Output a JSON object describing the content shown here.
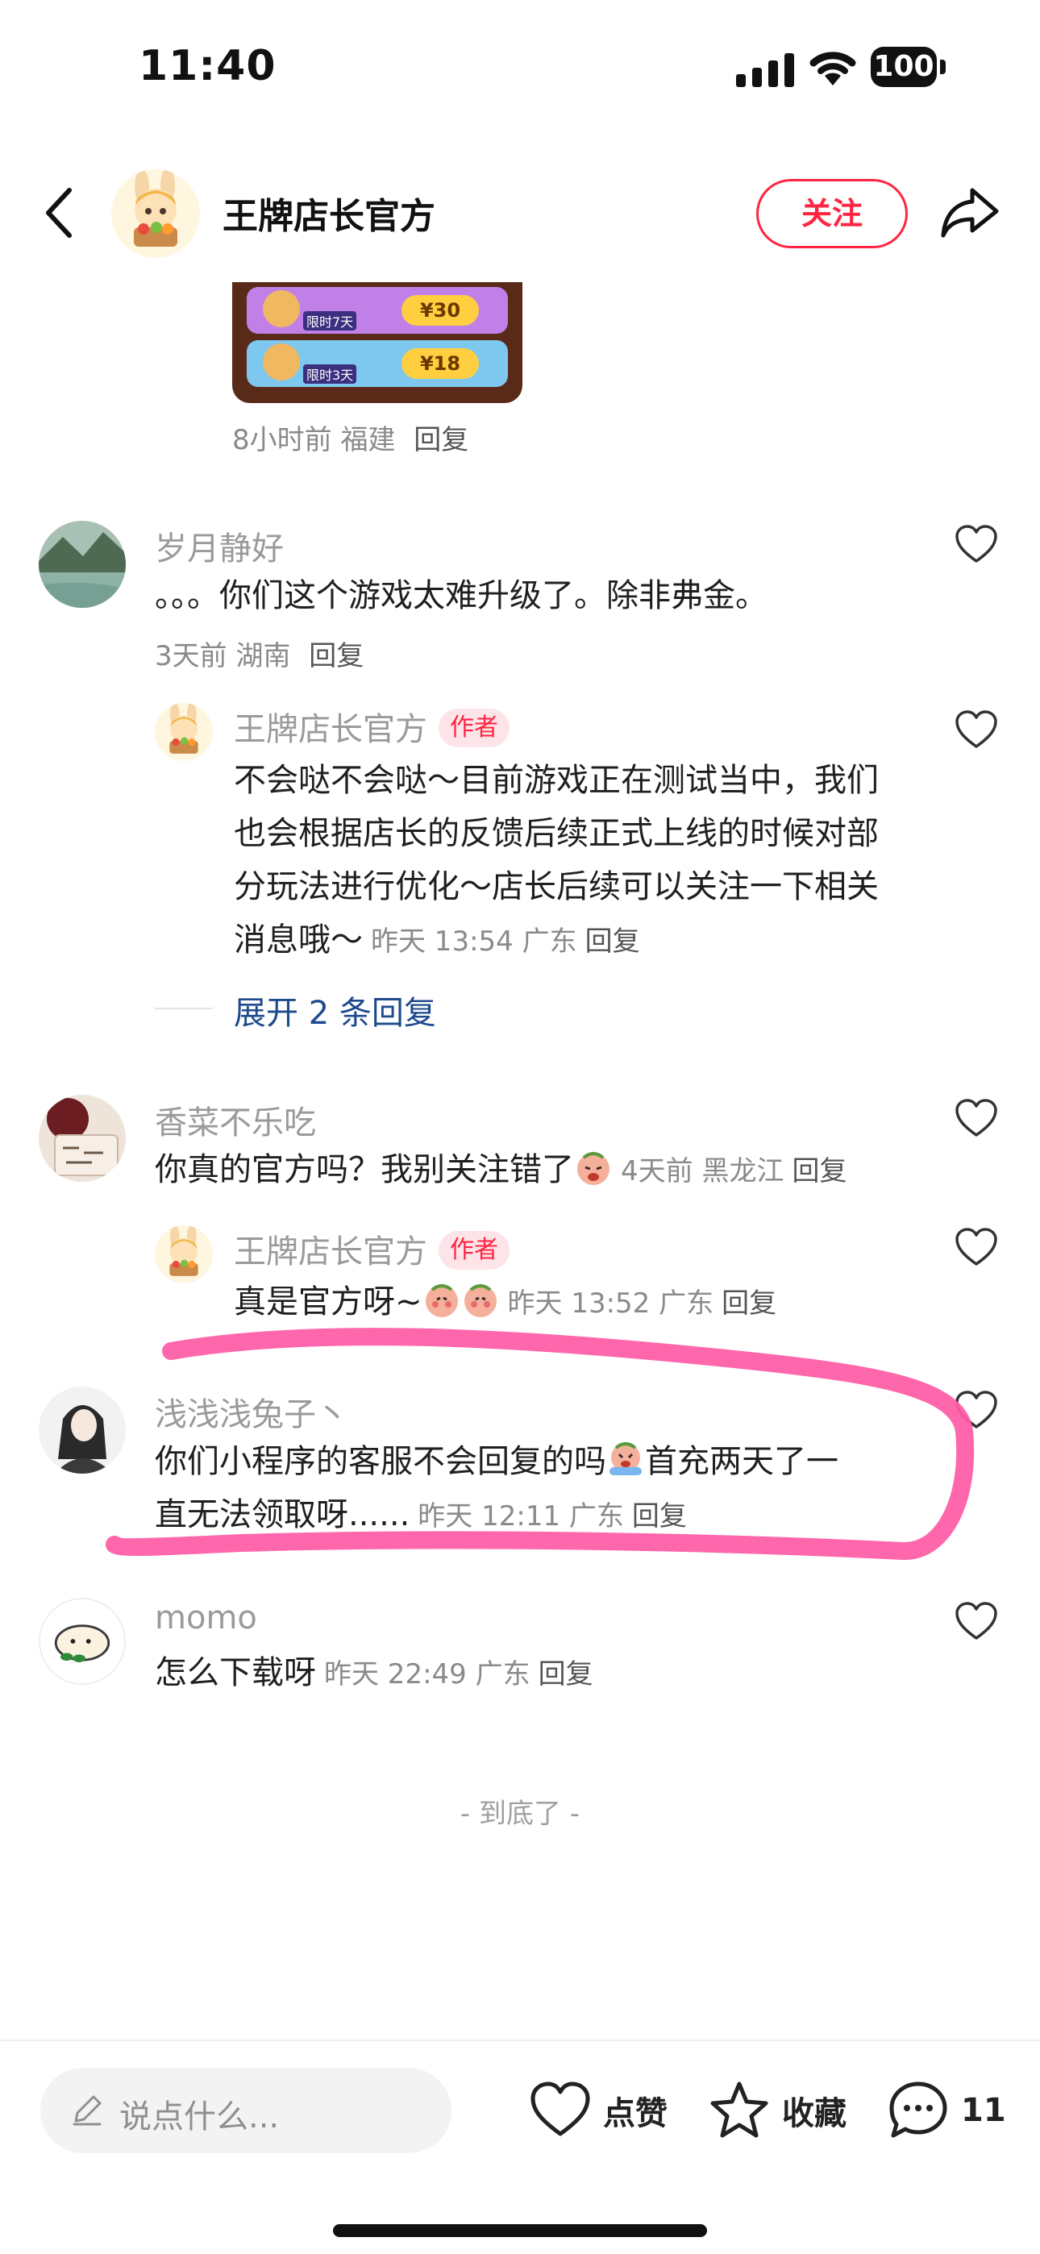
{
  "status_bar": {
    "time": "11:40",
    "battery": "100"
  },
  "header": {
    "name": "王牌店长官方",
    "follow_label": "关注"
  },
  "top_image": {
    "rewards": [
      {
        "price": "¥30",
        "tag": "限时7天"
      },
      {
        "price": "¥18",
        "tag": "限时3天"
      }
    ]
  },
  "top_meta": {
    "time_loc": "8小时前 福建",
    "reply": "回复"
  },
  "comments": [
    {
      "user": "岁月静好",
      "text": "。。。你们这个游戏太难升级了。除非弗金。",
      "meta": "3天前 湖南",
      "reply": "回复",
      "reply_thread": {
        "user": "王牌店长官方",
        "tag": "作者",
        "text": "不会哒不会哒～目前游戏正在测试当中，我们也会根据店长的反馈后续正式上线的时候对部分玩法进行优化～店长后续可以关注一下相关消息哦～",
        "meta": "昨天 13:54 广东",
        "reply": "回复"
      },
      "expand_label": "展开 2 条回复"
    },
    {
      "user": "香菜不乐吃",
      "text": "你真的官方吗？我别关注错了",
      "meta": "4天前 黑龙江",
      "reply": "回复",
      "reply_thread": {
        "user": "王牌店长官方",
        "tag": "作者",
        "text": "真是官方呀~",
        "meta": "昨天 13:52 广东",
        "reply": "回复"
      }
    },
    {
      "user": "浅浅浅兔子丶",
      "text_part1": "你们小程序的客服不会回复的吗",
      "text_part2": "首充两天了一",
      "text_line2": "直无法领取呀......",
      "meta": "昨天 12:11 广东",
      "reply": "回复"
    },
    {
      "user": "momo",
      "text": "怎么下载呀",
      "meta": "昨天 22:49 广东",
      "reply": "回复"
    }
  ],
  "end_text": "- 到底了 -",
  "bottom_bar": {
    "input_placeholder": "说点什么...",
    "like_label": "点赞",
    "collect_label": "收藏",
    "comment_count": "11"
  },
  "colors": {
    "accent": "#ff2442",
    "link": "#1e4a8c",
    "highlight": "#ff5aa5"
  }
}
